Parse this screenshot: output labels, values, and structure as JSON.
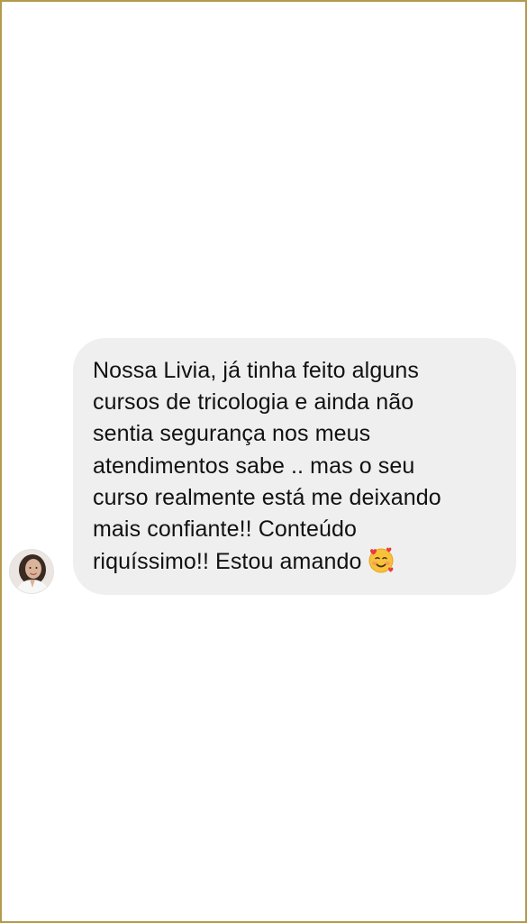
{
  "message": {
    "sender_avatar_icon": "profile-photo-avatar",
    "lines": [
      "Nossa Livia, já tinha feito alguns",
      "cursos de tricologia e ainda não",
      "sentia segurança nos meus",
      "atendimentos sabe .. mas o seu",
      "curso realmente está me deixando",
      "mais confiante!! Conteúdo",
      "riquíssimo!! Estou amando"
    ],
    "emoji_icon": "smiling-face-with-hearts-emoji"
  },
  "colors": {
    "frame_border": "#b39a4c",
    "bubble_background": "#efefef",
    "text": "#111111",
    "page_background": "#ffffff"
  }
}
